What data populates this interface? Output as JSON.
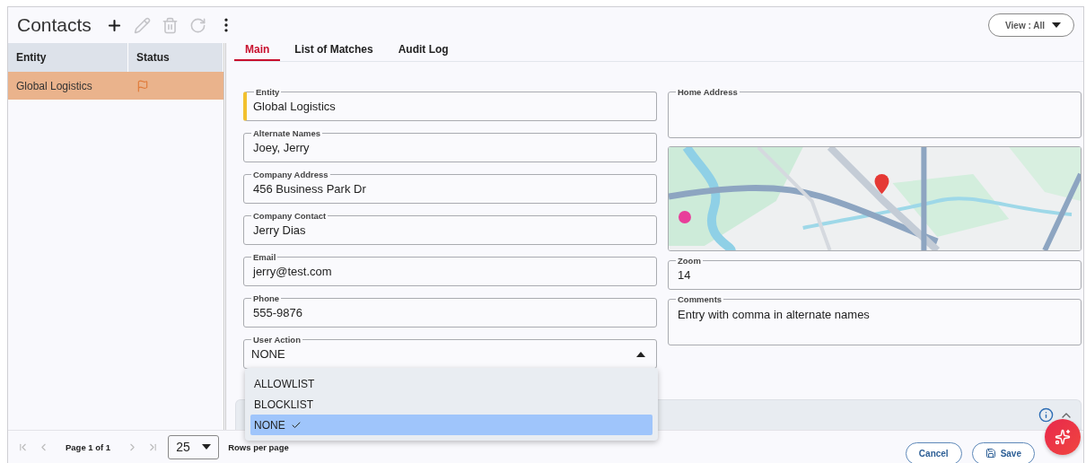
{
  "header": {
    "title": "Contacts",
    "view_button": "View : All",
    "toolbar": [
      {
        "kind": "add",
        "disabled": false
      },
      {
        "kind": "edit",
        "disabled": true
      },
      {
        "kind": "delete",
        "disabled": true
      },
      {
        "kind": "refresh",
        "disabled": true
      },
      {
        "kind": "more",
        "disabled": false
      }
    ]
  },
  "table": {
    "columns": [
      "Entity",
      "Status"
    ],
    "rows": [
      {
        "entity": "Global Logistics",
        "selected": true
      }
    ]
  },
  "tabs": [
    {
      "label": "Main",
      "selected": true
    },
    {
      "label": "List of Matches",
      "selected": false
    },
    {
      "label": "Audit Log",
      "selected": false
    }
  ],
  "form": {
    "fields": [
      {
        "label": "Entity",
        "value": "Global Logistics",
        "required": true
      },
      {
        "label": "Alternate Names",
        "value": "Joey, Jerry",
        "required": false
      },
      {
        "label": "Company Address",
        "value": "456 Business Park Dr",
        "required": false
      },
      {
        "label": "Company Contact",
        "value": "Jerry Dias",
        "required": false
      },
      {
        "label": "Email",
        "value": "jerry@test.com",
        "required": false
      },
      {
        "label": "Phone",
        "value": "555-9876",
        "required": false
      }
    ],
    "user_action": {
      "label": "User Action",
      "value": "NONE",
      "expanded": true,
      "options": [
        {
          "label": "ALLOWLIST",
          "selected": false
        },
        {
          "label": "BLOCKLIST",
          "selected": false
        },
        {
          "label": "NONE",
          "selected": true
        }
      ]
    },
    "home_address": {
      "label": "Home Address"
    },
    "zoom": {
      "label": "Zoom",
      "value": "14"
    },
    "comments": {
      "label": "Comments",
      "value": "Entry with comma in alternate names"
    }
  },
  "pagination": {
    "page": "Page 1 of 1",
    "rows": "25",
    "rows_label": "Rows per page"
  },
  "actions": {
    "cancel": "Cancel",
    "save": "Save"
  }
}
